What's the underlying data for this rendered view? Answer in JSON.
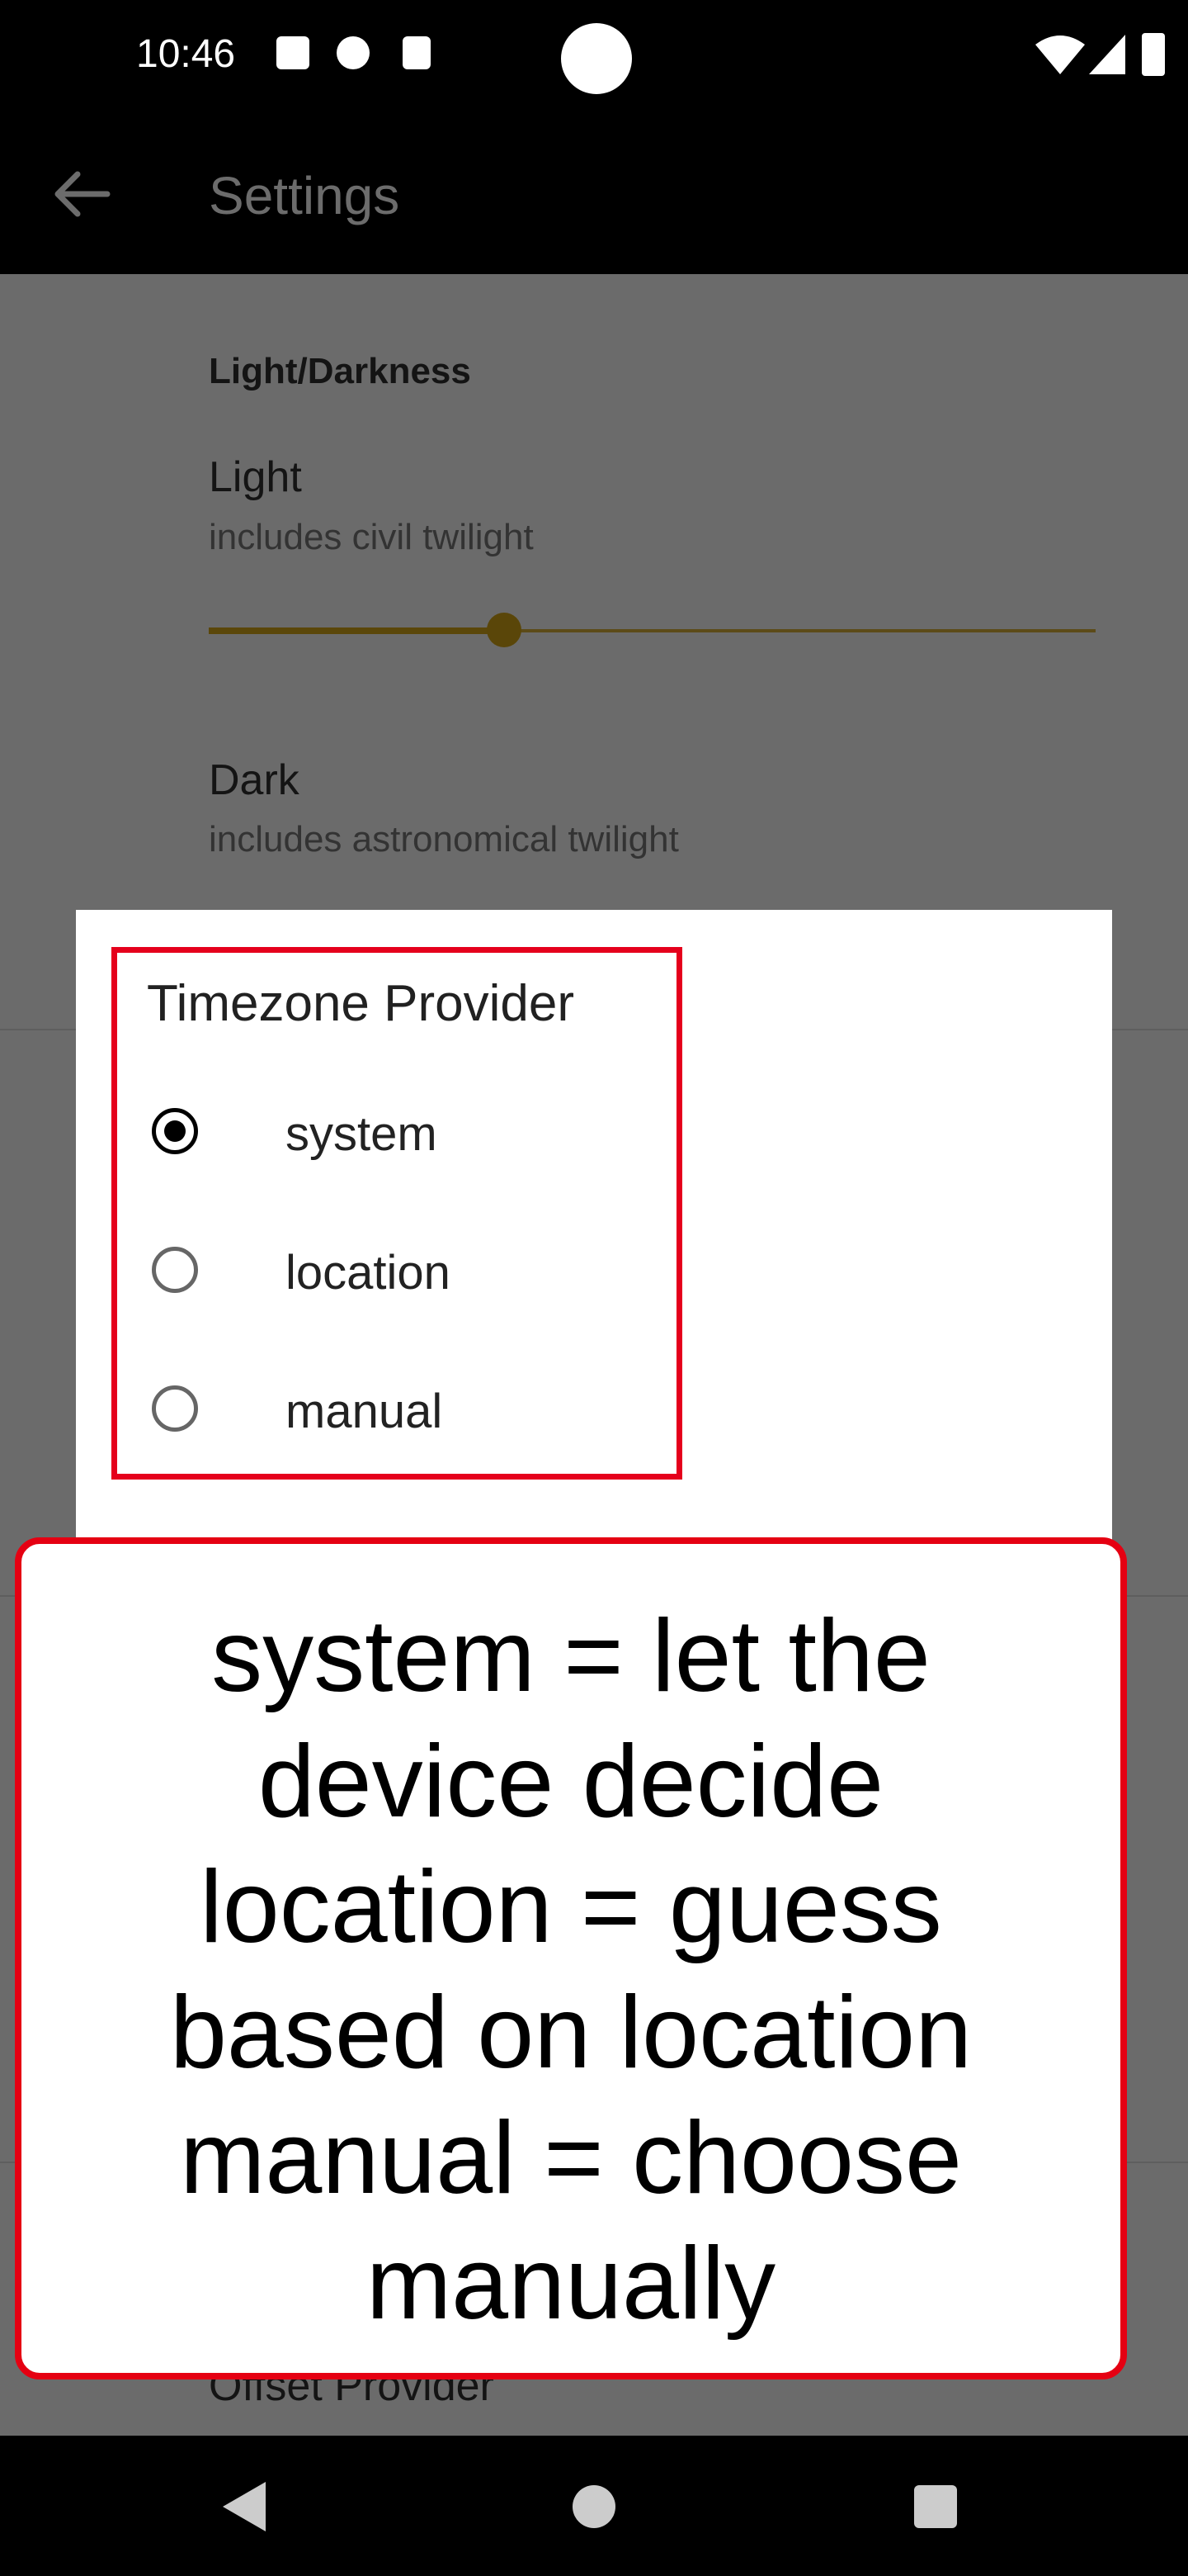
{
  "status_bar": {
    "time": "10:46",
    "notification_icons": [
      "a-icon",
      "p-icon",
      "sd-card-icon"
    ],
    "system_icons": [
      "wifi-icon",
      "signal-icon",
      "battery-icon"
    ]
  },
  "toolbar": {
    "title": "Settings",
    "back_icon": "arrow-left-icon"
  },
  "settings": {
    "section_title": "Light/Darkness",
    "light": {
      "title": "Light",
      "summary": "includes civil twilight",
      "slider_value_fraction": 0.33
    },
    "dark": {
      "title": "Dark",
      "summary": "includes astronomical twilight"
    },
    "partial_item": "Offset Provider"
  },
  "dialog": {
    "title": "Timezone Provider",
    "options": [
      {
        "label": "system",
        "checked": true
      },
      {
        "label": "location",
        "checked": false
      },
      {
        "label": "manual",
        "checked": false
      }
    ]
  },
  "callout": {
    "lines": [
      "system = let the",
      "device decide",
      "location = guess",
      "based on location",
      "manual = choose",
      "manually"
    ]
  },
  "nav_bar": {
    "icons": [
      "back-triangle-icon",
      "home-circle-icon",
      "recents-square-icon"
    ]
  },
  "colors": {
    "highlight": "#e5001c",
    "slider_accent": "#b8860b"
  }
}
